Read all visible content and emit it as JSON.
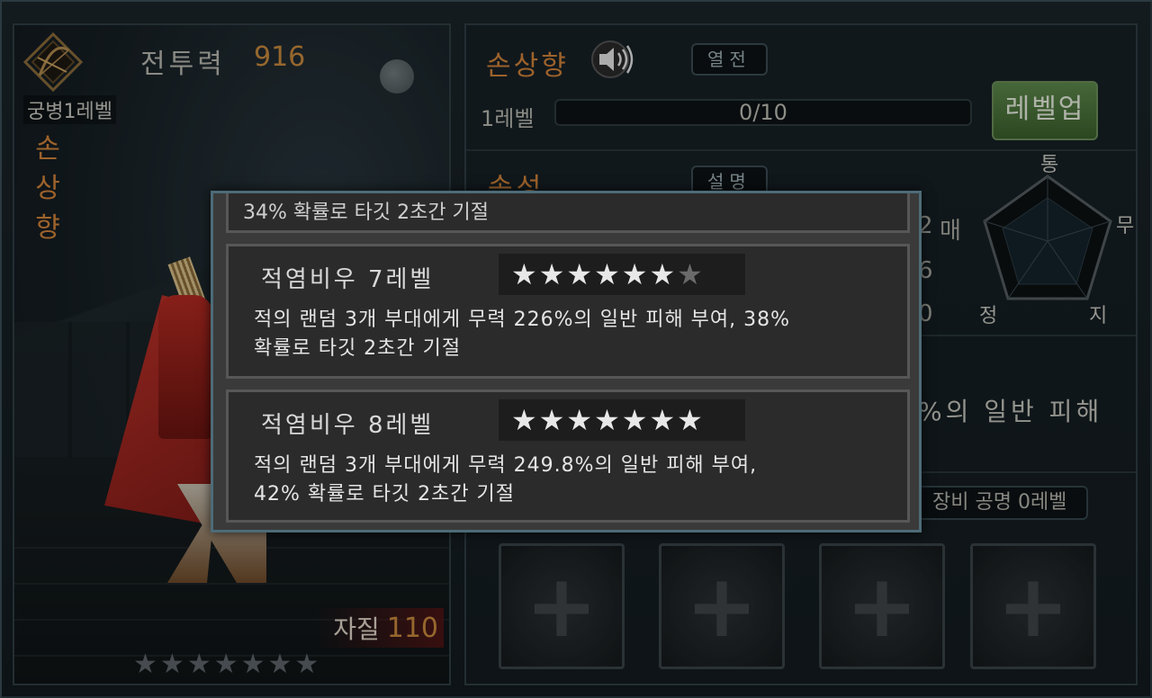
{
  "hero": {
    "power_label": "전투력",
    "power_value": "916",
    "class_label": "궁병1레벨",
    "name": "손상향",
    "aptitude_label": "자질",
    "aptitude_value": "110",
    "stars_total": 7
  },
  "skill_panel": {
    "skill_name": "손상향",
    "chip_detail": "열전",
    "level_label": "1레벨",
    "exp_current": 0,
    "exp_max": 10,
    "exp_text": "0/10",
    "levelup_label": "레벨업",
    "attr_title": "속성",
    "attr_chip": "설명",
    "radar_labels": {
      "top": "통",
      "right": "무",
      "bottom_right": "지",
      "bottom_left": "정",
      "left_partial": "매"
    },
    "stat_partials": [
      "2",
      "6",
      "0"
    ],
    "desc_partial": "%의 일반 피해",
    "equip_label": "장비 공명 0레벨",
    "slots": [
      "weapon-slot",
      "helmet-slot",
      "armor-slot",
      "accessory-slot"
    ]
  },
  "popup": {
    "top_cut_text": "34% 확률로 타깃 2초간 기절",
    "entries": [
      {
        "title": "적염비우 7레벨",
        "stars_filled": 6,
        "stars_total": 7,
        "desc_line1": "적의 랜덤 3개 부대에게 무력 226%의 일반 피해 부여, 38%",
        "desc_line2": "확률로 타깃 2초간 기절"
      },
      {
        "title": "적염비우 8레벨",
        "stars_filled": 7,
        "stars_total": 7,
        "desc_line1": "적의 랜덤 3개 부대에게 무력 249.8%의 일반 피해 부여,",
        "desc_line2": "42% 확률로 타깃 2초간 기절"
      }
    ]
  },
  "colors": {
    "accent_orange": "#d2833a",
    "levelup_green": "#4c7a3c",
    "popup_bg": "#2b2b2b"
  },
  "star_glyph": "★"
}
